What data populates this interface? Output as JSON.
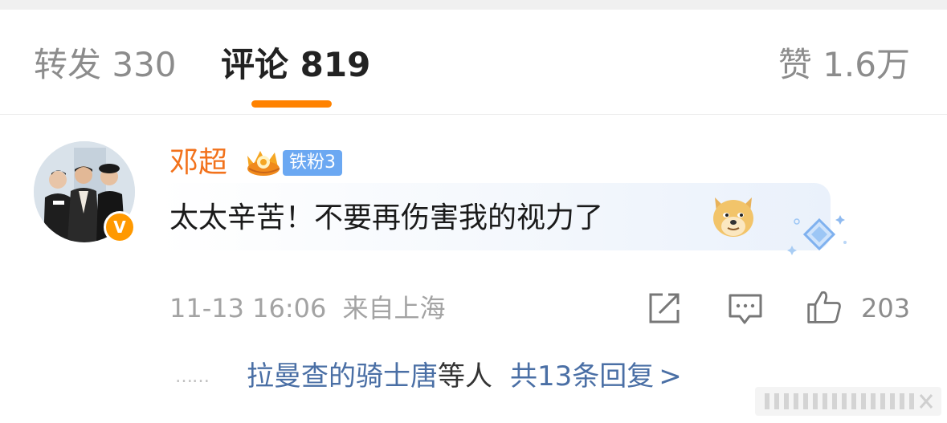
{
  "tabs": {
    "repost": "转发 330",
    "comments": "评论 819",
    "likes": "赞 1.6万"
  },
  "comment": {
    "username": "邓超",
    "fan_badge": "铁粉3",
    "text": "太太辛苦！不要再伤害我的视力了",
    "emoji": "doge-icon",
    "timestamp": "11-13 16:06",
    "location": "来自上海",
    "like_count": "203"
  },
  "replies": {
    "dots": "……",
    "names": "拉曼查的骑士唐",
    "suffix": "等人",
    "count": "共13条回复",
    "chevron": ">"
  },
  "colors": {
    "accent": "#ff8200",
    "username": "#f2721c",
    "link": "#4a6fa5",
    "fan_badge": "#6ba8f2",
    "verified": "#ff9900"
  }
}
